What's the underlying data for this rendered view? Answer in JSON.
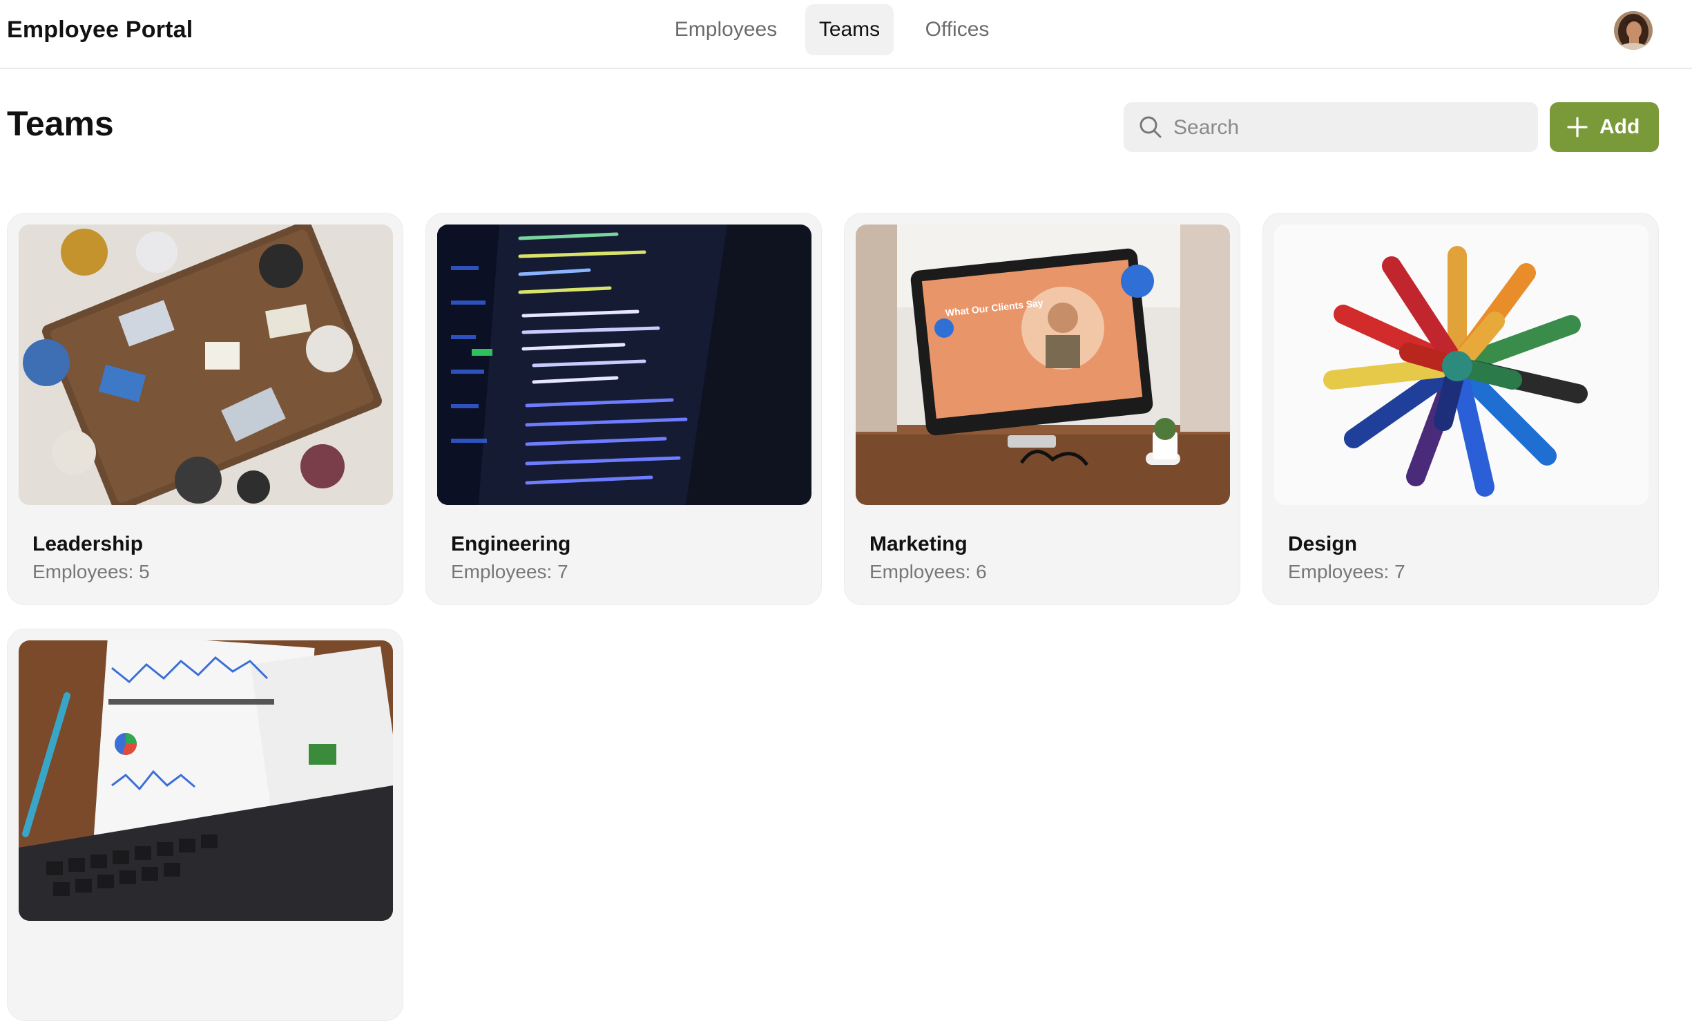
{
  "app": {
    "title": "Employee Portal"
  },
  "nav": {
    "tabs": [
      {
        "label": "Employees",
        "active": false
      },
      {
        "label": "Teams",
        "active": true
      },
      {
        "label": "Offices",
        "active": false
      }
    ]
  },
  "user": {
    "avatar_icon": "user-avatar"
  },
  "page": {
    "title": "Teams"
  },
  "search": {
    "placeholder": "Search",
    "value": "",
    "icon": "search-icon"
  },
  "add_button": {
    "label": "Add",
    "icon": "plus-icon",
    "color": "#7a9a3a"
  },
  "teams": [
    {
      "name": "Leadership",
      "employees": "Employees: 5",
      "image": "meeting-table-photo"
    },
    {
      "name": "Engineering",
      "employees": "Employees: 7",
      "image": "code-screen-photo"
    },
    {
      "name": "Marketing",
      "employees": "Employees: 6",
      "image": "imac-presentation-photo",
      "image_text": "What Our Clients Say"
    },
    {
      "name": "Design",
      "employees": "Employees: 7",
      "image": "colored-pencils-photo"
    },
    {
      "name": "",
      "employees": "",
      "image": "analytics-report-photo"
    }
  ]
}
